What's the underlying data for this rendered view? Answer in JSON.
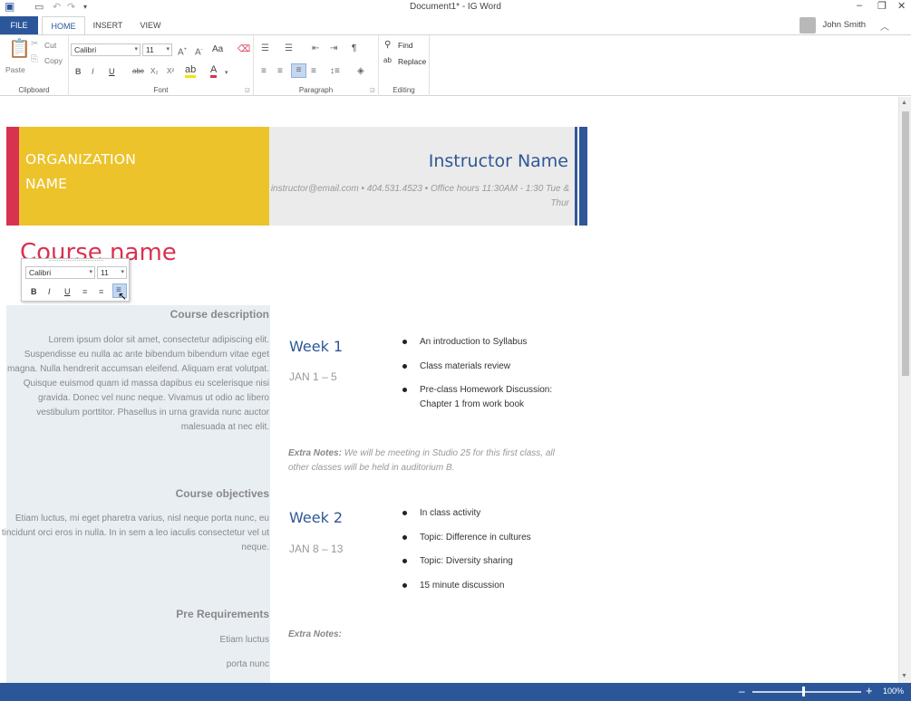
{
  "window": {
    "title": "Document1* - IG Word",
    "minimize_glyph": "–",
    "restore_glyph": "❐",
    "close_glyph": "✕"
  },
  "tabs": {
    "file": "FILE",
    "home": "HOME",
    "insert": "INSERT",
    "view": "VIEW"
  },
  "user": {
    "name": "John Smith"
  },
  "ribbon": {
    "clipboard": {
      "label": "Clipboard",
      "paste": "Paste",
      "cut": "Cut",
      "copy": "Copy"
    },
    "font": {
      "label": "Font",
      "family": "Calibri",
      "size": "11",
      "bold": "B",
      "italic": "I",
      "underline": "U",
      "strike": "abc",
      "sub": "X₂",
      "sup": "X²",
      "case": "Aa"
    },
    "paragraph": {
      "label": "Paragraph",
      "pilcrow": "¶"
    },
    "editing": {
      "label": "Editing",
      "find": "Find",
      "replace": "Replace"
    }
  },
  "doc": {
    "org_line1": "ORGANIZATION",
    "org_line2": "NAME",
    "instructor_name": "Instructor Name",
    "instructor_contact": "instructor@email.com • 404.531.4523 • Office hours 11:30AM - 1:30 Tue & Thur",
    "course_name": "Course name",
    "left": {
      "desc_heading": "Course description",
      "desc_body": "Lorem ipsum dolor sit amet, consectetur adipiscing elit. Suspendisse eu nulla ac ante bibendum bibendum vitae eget magna. Nulla hendrerit accumsan eleifend. Aliquam erat volutpat. Quisque euismod quam id massa dapibus eu scelerisque nisi gravida. Donec vel nunc neque. Vivamus ut odio ac libero vestibulum porttitor. Phasellus in urna gravida nunc auctor malesuada at nec elit.",
      "obj_heading": "Course objectives",
      "obj_body": "Etiam luctus, mi eget pharetra varius, nisl neque porta nunc, eu tincidunt orci eros in nulla. In in sem a leo iaculis consectetur vel ut neque.",
      "pre_heading": "Pre Requirements",
      "pre_line1": "Etiam luctus",
      "pre_line2": "porta nunc"
    },
    "week1": {
      "title": "Week 1",
      "dates": "JAN 1 – 5",
      "items": [
        "An introduction to Syllabus",
        "Class materials review",
        "Pre-class Homework Discussion: Chapter 1 from work book"
      ],
      "notes_label": "Extra Notes:",
      "notes_text": "We will be meeting in Studio 25 for this first class, all other classes will be held in auditorium B."
    },
    "week2": {
      "title": "Week 2",
      "dates": "JAN 8 – 13",
      "items": [
        "In class activity",
        "Topic: Difference in cultures",
        "Topic: Diversity sharing",
        "15 minute discussion"
      ],
      "notes_label": "Extra Notes:"
    }
  },
  "mini_toolbar": {
    "family": "Calibri",
    "size": "11",
    "bold": "B",
    "italic": "I",
    "underline": "U"
  },
  "status": {
    "zoom": "100%",
    "zoom_level": 0.47
  },
  "colors": {
    "brand": "#2b579a",
    "accent_red": "#d93251",
    "accent_yellow": "#ecc32b",
    "accent_blue": "#2f5797"
  }
}
